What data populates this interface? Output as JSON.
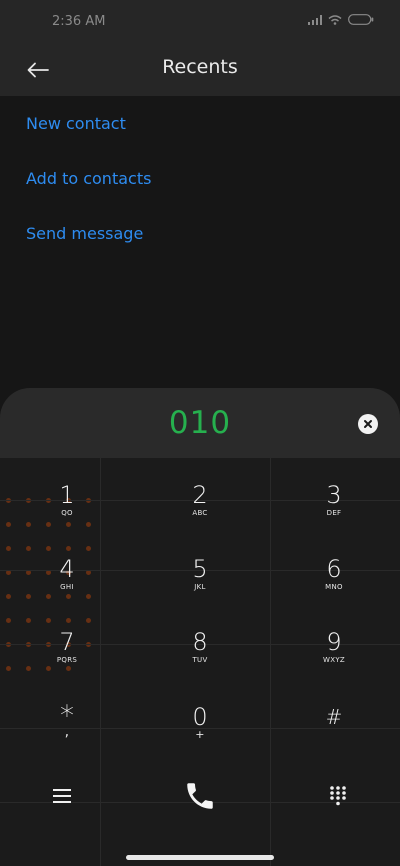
{
  "status": {
    "time": "2:36 AM"
  },
  "header": {
    "title": "Recents"
  },
  "actions": [
    {
      "label": "New contact"
    },
    {
      "label": "Add to contacts"
    },
    {
      "label": "Send message"
    }
  ],
  "dialer": {
    "number": "010",
    "keys": [
      {
        "digit": "1",
        "letters": "QO"
      },
      {
        "digit": "2",
        "letters": "ABC"
      },
      {
        "digit": "3",
        "letters": "DEF"
      },
      {
        "digit": "4",
        "letters": "GHI"
      },
      {
        "digit": "5",
        "letters": "JKL"
      },
      {
        "digit": "6",
        "letters": "MNO"
      },
      {
        "digit": "7",
        "letters": "PQRS"
      },
      {
        "digit": "8",
        "letters": "TUV"
      },
      {
        "digit": "9",
        "letters": "WXYZ"
      },
      {
        "digit": "*",
        "letters": ","
      },
      {
        "digit": "0",
        "letters": "+"
      },
      {
        "digit": "#",
        "letters": ""
      }
    ]
  },
  "colors": {
    "accent_blue": "#2e8cf0",
    "number_green": "#26b04e",
    "background": "#161616"
  },
  "icons": [
    "back-arrow-icon",
    "clear-input-icon",
    "menu-icon",
    "phone-call-icon",
    "dialpad-icon",
    "wifi-icon",
    "signal-icon",
    "battery-icon"
  ]
}
